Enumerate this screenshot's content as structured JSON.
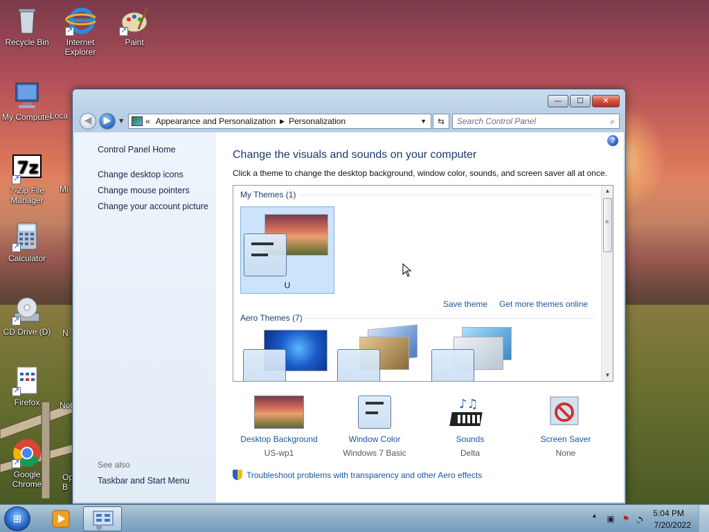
{
  "desktop": {
    "icons": [
      {
        "label": "Recycle Bin"
      },
      {
        "label": "Internet Explorer"
      },
      {
        "label": "Paint"
      },
      {
        "label": "My Computer"
      },
      {
        "label": "Loca"
      },
      {
        "label": "7-Zip File Manager"
      },
      {
        "label": "Mi"
      },
      {
        "label": "Calculator"
      },
      {
        "label": "CD Drive (D)"
      },
      {
        "label": "N"
      },
      {
        "label": "Firefox"
      },
      {
        "label": "Not"
      },
      {
        "label": "Google Chrome"
      },
      {
        "label": "Op B"
      }
    ]
  },
  "window": {
    "controls": {
      "minimize": "—",
      "maximize": "☐",
      "close": "✕"
    },
    "nav": {
      "back": "◀",
      "forward": "▶",
      "dropdown": "▼"
    },
    "address": {
      "prefix": "«",
      "crumbs": [
        "Appearance and Personalization",
        "Personalization"
      ],
      "separator": "▶",
      "dropdown": "▼"
    },
    "refresh": "⇆",
    "search": {
      "placeholder": "Search Control Panel",
      "icon": "⌕"
    },
    "help": "?"
  },
  "sidebar": {
    "home": "Control Panel Home",
    "links": [
      "Change desktop icons",
      "Change mouse pointers",
      "Change your account picture"
    ],
    "see_also_label": "See also",
    "see_also_links": [
      "Taskbar and Start Menu"
    ]
  },
  "main": {
    "title": "Change the visuals and sounds on your computer",
    "subtitle": "Click a theme to change the desktop background, window color, sounds, and screen saver all at once.",
    "my_themes_label": "My Themes (1)",
    "my_theme_name": "U",
    "save_theme": "Save theme",
    "get_more": "Get more themes online",
    "aero_label": "Aero Themes (7)",
    "scroll": {
      "up": "▲",
      "down": "▼"
    }
  },
  "bottom": {
    "items": [
      {
        "label": "Desktop Background",
        "value": "US-wp1"
      },
      {
        "label": "Window Color",
        "value": "Windows 7 Basic"
      },
      {
        "label": "Sounds",
        "value": "Delta"
      },
      {
        "label": "Screen Saver",
        "value": "None"
      }
    ],
    "troubleshoot": "Troubleshoot problems with transparency and other Aero effects"
  },
  "taskbar": {
    "start": "⊞",
    "tray_arrow": "▲",
    "clock_time": "5:04 PM",
    "clock_date": "7/20/2022"
  },
  "colors": {
    "link": "#1a56a0",
    "title": "#1a3a6a",
    "accent": "#3a78c8"
  }
}
